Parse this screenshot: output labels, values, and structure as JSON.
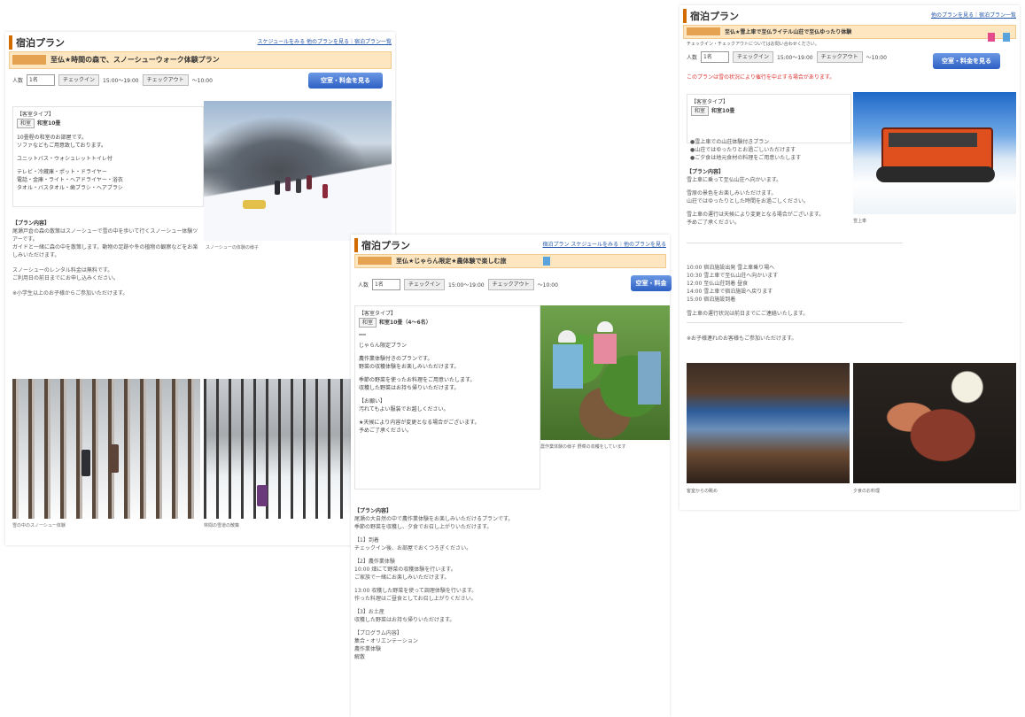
{
  "left": {
    "header_title": "宿泊プラン",
    "header_links": "スケジュールをみる 他のプランを見る｜宿泊プラン一覧",
    "plan_tag": "",
    "plan_name": "至仏★時間の森で、スノーシューウォーク体験プラン",
    "people_label": "人数",
    "people_value": "1名",
    "checkin_label": "チェックイン",
    "checkin_time": "15:00〜19:00",
    "checkout_label": "チェックアウト",
    "checkout_time": "〜10:00",
    "reserve_label": "空室・料金を見る",
    "room_type_label": "【客室タイプ】",
    "room_chip": "和室",
    "room_name": "和室10畳",
    "room_desc": [
      "10畳程の和室のお部屋です。",
      "ソファなどもご用意致しております。",
      "",
      "ユニットバス・ウォシュレットトイレ付",
      "",
      "テレビ・冷蔵庫・ポット・ドライヤー",
      "電話・金庫・ライト・ヘアドライヤー・浴衣",
      "タオル・バスタオル・歯ブラシ・ヘアブラシ"
    ],
    "plan_content_head": "【プラン内容】",
    "plan_content": [
      "尾瀬戸倉の森の散策はスノーシューで雪の中を歩いて行くスノーシュー体験ツアーです。",
      "ガイドと一緒に森の中を散策します。動物の足跡や冬の植物の観察などをお楽しみいただけます。",
      "",
      "スノーシューのレンタル料金は無料です。",
      "ご利用日の前日までにお申し込みください。",
      "",
      "※小学生以上のお子様からご参加いただけます。"
    ],
    "caption_top": "スノーシューの体験の様子",
    "caption_bl": "雪の中のスノーシュー体験",
    "caption_br": "林間の雪道の散策"
  },
  "mid": {
    "header_title": "宿泊プラン",
    "header_links": "宿泊プラン スケジュールをみる｜他のプランを見る",
    "plan_tag": "",
    "plan_name": "至仏★じゃらん限定★農体験で楽しむ旅",
    "badge": "",
    "people_label": "人数",
    "people_value": "1名",
    "checkin_label": "チェックイン",
    "checkin_time": "15:00〜19:00",
    "checkout_label": "チェックアウト",
    "checkout_time": "〜10:00",
    "reserve_label": "空室・料金",
    "room_type_label": "【客室タイプ】",
    "room_chip": "和室",
    "room_name": "和室10畳（4〜6名）",
    "chip2": "",
    "room_desc": [
      "じゃらん限定プラン",
      "",
      "農作業体験付きのプランです。",
      "野菜の収穫体験をお楽しみいただけます。",
      "",
      "季節の野菜を使ったお料理をご用意いたします。",
      "収穫した野菜はお持ち帰りいただけます。",
      "",
      "【お願い】",
      "汚れてもよい服装でお越しください。",
      "",
      "★天候により内容が変更となる場合がございます。",
      "予めご了承ください。"
    ],
    "caption_top": "農作業体験の様子 野菜の収穫をしています",
    "plan_content_head": "【プラン内容】",
    "plan_content": [
      "尾瀬の大自然の中で農作業体験をお楽しみいただけるプランです。",
      "季節の野菜を収穫し、夕食でお召し上がりいただけます。",
      "",
      "【1】到着",
      "チェックイン後、お部屋でおくつろぎください。",
      "",
      "【2】農作業体験",
      "10:00 畑にて野菜の収穫体験を行います。",
      "       ご家族で一緒にお楽しみいただけます。",
      "",
      "13:00 収穫した野菜を使って調理体験を行います。",
      "       作った料理はご昼食としてお召し上がりください。",
      "",
      "【3】お土産",
      "収穫した野菜はお持ち帰りいただけます。",
      "",
      "【プログラム内容】",
      "集合・オリエンテーション",
      "農作業体験",
      "解散"
    ]
  },
  "right": {
    "header_title": "宿泊プラン",
    "header_links": "他のプランを見る｜宿泊プラン一覧",
    "plan_tag": "",
    "plan_name": "至仏★雪上車で至仏ライテル山荘で至仏ゆったり体験",
    "badge_pink": "",
    "badge_blue": "",
    "sub_note": "チェックイン・チェックアウトについてはお問い合わせください。",
    "people_label": "人数",
    "people_value": "1名",
    "checkin_label": "チェックイン",
    "checkin_time": "15:00〜19:00",
    "checkout_label": "チェックアウト",
    "checkout_time": "〜10:00",
    "reserve_label": "空室・料金を見る",
    "notice": "このプランは雪の状況により催行を中止する場合があります。",
    "room_type_label": "【客室タイプ】",
    "room_chip": "和室",
    "room_name": "和室10畳",
    "room_desc": [
      "●雪上車での山荘体験付きプラン",
      "●山荘ではゆったりとお過ごしいただけます",
      "●ご夕食は地元食材の料理をご用意いたします"
    ],
    "plan_content_head": "【プラン内容】",
    "plan_content": [
      "雪上車に乗って至仏山荘へ向かいます。",
      "",
      "雪原の景色をお楽しみいただけます。",
      "山荘ではゆったりとした時間をお過ごしください。",
      "",
      "雪上車の運行は天候により変更となる場合がございます。",
      "予めご了承ください。"
    ],
    "schedule": [
      "10:00 宿泊施設出発 雪上車乗り場へ",
      "10:30 雪上車で至仏山荘へ向かいます",
      "12:00 至仏山荘到着 昼食",
      "14:00 雪上車で宿泊施設へ戻ります",
      "15:00 宿泊施設到着"
    ],
    "schedule_note": "雪上車の運行状況は前日までにご連絡いたします。",
    "footer_note": "※お子様連れのお客様もご参加いただけます。",
    "caption_top": "雪上車",
    "caption_bl": "客室からの眺め",
    "caption_br": "夕食のお料理"
  }
}
